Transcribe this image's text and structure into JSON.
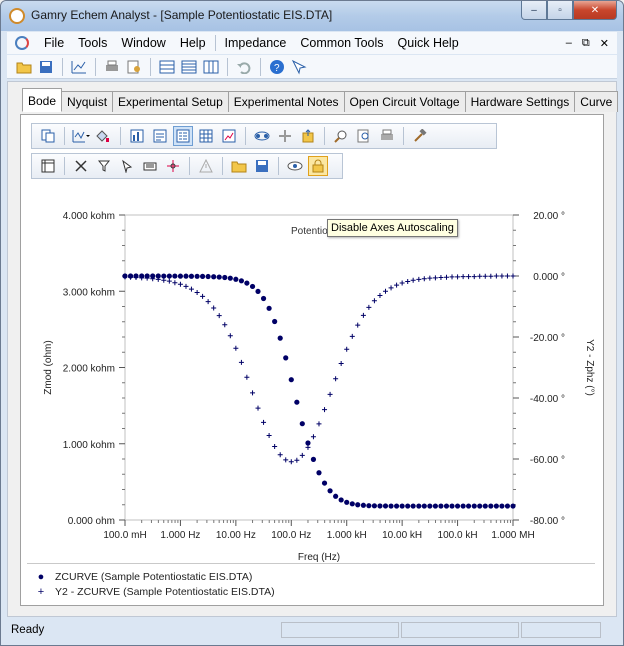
{
  "window": {
    "title": "Gamry Echem Analyst - [Sample Potentiostatic EIS.DTA]",
    "minimize_label": "–",
    "restore_label": "▫",
    "close_label": "✕"
  },
  "menu": {
    "items": [
      "File",
      "Tools",
      "Window",
      "Help",
      "Impedance",
      "Common Tools",
      "Quick Help"
    ],
    "mdi_min": "–",
    "mdi_restore": "⧉",
    "mdi_close": "✕"
  },
  "tabs": [
    "Bode",
    "Nyquist",
    "Experimental Setup",
    "Experimental Notes",
    "Open Circuit Voltage",
    "Hardware Settings",
    "Curve"
  ],
  "active_tab": "Bode",
  "plot": {
    "title_partial": "Potentio",
    "tooltip": "Disable Axes Autoscaling"
  },
  "chart_data": {
    "type": "scatter",
    "title": "Potentio",
    "xlabel": "Freq (Hz)",
    "ylabel_left": "Zmod (ohm)",
    "ylabel_right": "Y2 - Zphz (°)",
    "x_scale": "log",
    "x_ticks": [
      "100.0 mH",
      "1.000 Hz",
      "10.00 Hz",
      "100.0 Hz",
      "1.000 kH",
      "10.00 kH",
      "100.0 kH",
      "1.000 MH"
    ],
    "x_tick_values": [
      0.1,
      1,
      10,
      100,
      1000,
      10000,
      100000,
      1000000
    ],
    "y_left_ticks": [
      "0.000 ohm",
      "1.000 kohm",
      "2.000 kohm",
      "3.000 kohm",
      "4.000 kohm"
    ],
    "y_left_range": [
      0,
      4000
    ],
    "y_right_ticks": [
      "-80.00 °",
      "-60.00 °",
      "-40.00 °",
      "-20.00 °",
      "0.000 °",
      "20.00 °"
    ],
    "y_right_range": [
      -80,
      20
    ],
    "x_range": [
      0.1,
      1000000
    ],
    "series": [
      {
        "name": "ZCURVE (Sample Potentiostatic EIS.DTA)",
        "axis": "left",
        "marker": "dot",
        "color": "#000066",
        "x": [
          0.1,
          0.126,
          0.158,
          0.2,
          0.251,
          0.316,
          0.398,
          0.501,
          0.631,
          0.794,
          1,
          1.26,
          1.58,
          2,
          2.51,
          3.16,
          3.98,
          5.01,
          6.31,
          7.94,
          10,
          12.6,
          15.8,
          20,
          25.1,
          31.6,
          39.8,
          50.1,
          63.1,
          79.4,
          100,
          126,
          158,
          200,
          251,
          316,
          398,
          501,
          631,
          794,
          1000,
          1260,
          1580,
          2000,
          2510,
          3160,
          3980,
          5010,
          6310,
          7940,
          10000,
          12600,
          15800,
          20000,
          25100,
          31600,
          39800,
          50100,
          63100,
          79400,
          100000,
          126000,
          158000,
          200000,
          251000,
          316000,
          398000,
          501000,
          631000,
          794000,
          1000000
        ],
        "y": [
          3200,
          3200,
          3200,
          3200,
          3200,
          3200,
          3200,
          3199,
          3199,
          3199,
          3198,
          3198,
          3197,
          3196,
          3195,
          3193,
          3190,
          3186,
          3180,
          3171,
          3157,
          3137,
          3107,
          3063,
          2998,
          2905,
          2776,
          2603,
          2385,
          2126,
          1840,
          1545,
          1263,
          1010,
          795,
          620,
          484,
          383,
          311,
          263,
          232,
          212,
          200,
          193,
          188,
          186,
          184,
          184,
          183,
          183,
          183,
          183,
          183,
          183,
          183,
          183,
          183,
          183,
          183,
          183,
          183,
          183,
          183,
          183,
          183,
          183,
          183,
          183,
          183,
          183,
          183
        ]
      },
      {
        "name": "Y2 - ZCURVE (Sample Potentiostatic EIS.DTA)",
        "axis": "right",
        "marker": "plus",
        "color": "#000066",
        "x": [
          0.1,
          0.126,
          0.158,
          0.2,
          0.251,
          0.316,
          0.398,
          0.501,
          0.631,
          0.794,
          1,
          1.26,
          1.58,
          2,
          2.51,
          3.16,
          3.98,
          5.01,
          6.31,
          7.94,
          10,
          12.6,
          15.8,
          20,
          25.1,
          31.6,
          39.8,
          50.1,
          63.1,
          79.4,
          100,
          126,
          158,
          200,
          251,
          316,
          398,
          501,
          631,
          794,
          1000,
          1260,
          1580,
          2000,
          2510,
          3160,
          3980,
          5010,
          6310,
          7940,
          10000,
          12600,
          15800,
          20000,
          25100,
          31600,
          39800,
          50100,
          63100,
          79400,
          100000,
          126000,
          158000,
          200000,
          251000,
          316000,
          398000,
          501000,
          631000,
          794000,
          1000000
        ],
        "y": [
          -0.3,
          -0.4,
          -0.5,
          -0.6,
          -0.7,
          -0.9,
          -1.1,
          -1.4,
          -1.7,
          -2.2,
          -2.7,
          -3.4,
          -4.3,
          -5.4,
          -6.7,
          -8.4,
          -10.5,
          -13.0,
          -16.0,
          -19.6,
          -23.7,
          -28.3,
          -33.2,
          -38.3,
          -43.3,
          -48.0,
          -52.3,
          -55.9,
          -58.6,
          -60.3,
          -60.9,
          -60.4,
          -58.8,
          -56.2,
          -52.7,
          -48.5,
          -43.8,
          -38.8,
          -33.7,
          -28.7,
          -24.0,
          -19.8,
          -16.1,
          -12.9,
          -10.3,
          -8.1,
          -6.4,
          -5.0,
          -3.9,
          -3.0,
          -2.3,
          -1.8,
          -1.4,
          -1.1,
          -0.9,
          -0.7,
          -0.6,
          -0.5,
          -0.4,
          -0.3,
          -0.3,
          -0.2,
          -0.2,
          -0.2,
          -0.1,
          -0.1,
          -0.1,
          0.0,
          0.0,
          0.0,
          0.0
        ]
      }
    ],
    "legend_placement": "bottom-left"
  },
  "legend": [
    {
      "symbol": "●",
      "label": "ZCURVE (Sample Potentiostatic EIS.DTA)"
    },
    {
      "symbol": "+",
      "label": "Y2 - ZCURVE (Sample Potentiostatic EIS.DTA)"
    }
  ],
  "status": {
    "text": "Ready"
  }
}
